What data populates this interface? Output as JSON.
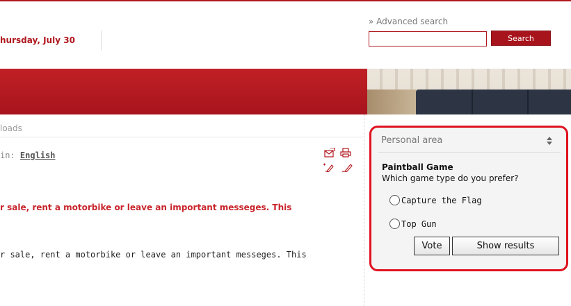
{
  "header": {
    "date_text": "hursday, July 30"
  },
  "search": {
    "advanced_link": "» Advanced search",
    "input_value": "",
    "button_label": "Search"
  },
  "breadcrumb": {
    "text": "loads"
  },
  "article": {
    "language_label": "in:",
    "language_value": "English",
    "intro_bold": "r sale, rent a motorbike or leave an important messeges. This",
    "intro_plain": "r sale, rent a motorbike or leave an important messeges. This",
    "tools": [
      "email-icon",
      "print-icon",
      "add-note-icon",
      "edit-icon"
    ]
  },
  "personal_area": {
    "title": "Personal area",
    "toggle_icon": "sort-updown-icon",
    "poll": {
      "title": "Paintball Game",
      "question": "Which game type do you prefer?",
      "options": [
        "Capture the Flag",
        "Top Gun"
      ],
      "vote_label": "Vote",
      "results_label": "Show results"
    }
  },
  "colors": {
    "brand_red": "#b0181f",
    "highlight_red": "#e0121f",
    "intro_red": "#c8242b"
  }
}
